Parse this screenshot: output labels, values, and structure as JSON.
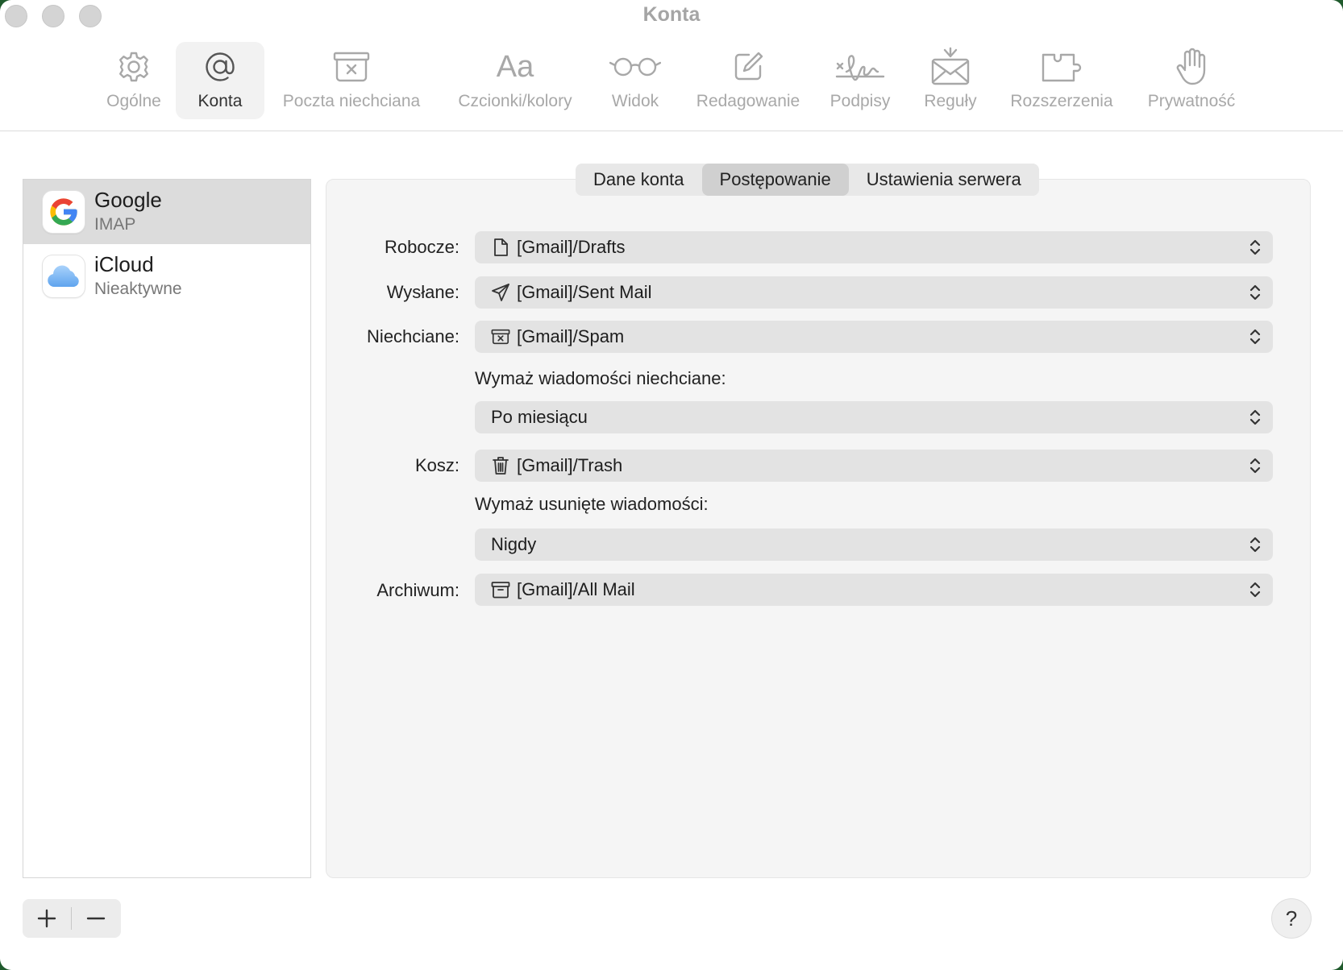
{
  "window": {
    "title": "Konta"
  },
  "toolbar": {
    "items": [
      {
        "label": "Ogólne",
        "icon": "gear-icon"
      },
      {
        "label": "Konta",
        "icon": "at-icon"
      },
      {
        "label": "Poczta niechciana",
        "icon": "junk-tray-icon"
      },
      {
        "label": "Czcionki/kolory",
        "icon": "font-icon",
        "glyph": "Aa"
      },
      {
        "label": "Widok",
        "icon": "glasses-icon"
      },
      {
        "label": "Redagowanie",
        "icon": "compose-icon"
      },
      {
        "label": "Podpisy",
        "icon": "signature-icon"
      },
      {
        "label": "Reguły",
        "icon": "rules-envelope-icon"
      },
      {
        "label": "Rozszerzenia",
        "icon": "puzzle-icon"
      },
      {
        "label": "Prywatność",
        "icon": "hand-icon"
      }
    ],
    "active": "Konta"
  },
  "accounts": [
    {
      "name": "Google",
      "type": "IMAP",
      "icon": "google-logo",
      "selected": true
    },
    {
      "name": "iCloud",
      "type": "Nieaktywne",
      "icon": "icloud-logo",
      "selected": false
    }
  ],
  "tabs": [
    {
      "label": "Dane konta"
    },
    {
      "label": "Postępowanie",
      "active": true
    },
    {
      "label": "Ustawienia serwera"
    }
  ],
  "behavior": {
    "drafts": {
      "label": "Robocze:",
      "value": "[Gmail]/Drafts",
      "icon": "document-icon"
    },
    "sent": {
      "label": "Wysłane:",
      "value": "[Gmail]/Sent Mail",
      "icon": "paper-plane-icon"
    },
    "junk": {
      "label": "Niechciane:",
      "value": "[Gmail]/Spam",
      "icon": "junk-tray-icon"
    },
    "junk_erase_label": "Wymaż wiadomości niechciane:",
    "junk_erase_value": "Po miesiącu",
    "trash": {
      "label": "Kosz:",
      "value": "[Gmail]/Trash",
      "icon": "trash-icon"
    },
    "trash_erase_label": "Wymaż usunięte wiadomości:",
    "trash_erase_value": "Nigdy",
    "archive": {
      "label": "Archiwum:",
      "value": "[Gmail]/All Mail",
      "icon": "archive-box-icon"
    }
  },
  "bottom": {
    "add": "+",
    "remove": "–",
    "help": "?"
  },
  "colors": {
    "google_blue": "#4285F4",
    "google_red": "#EA4335",
    "google_yellow": "#FBBC05",
    "google_green": "#34A853",
    "icloud": "#7fb7f0"
  }
}
